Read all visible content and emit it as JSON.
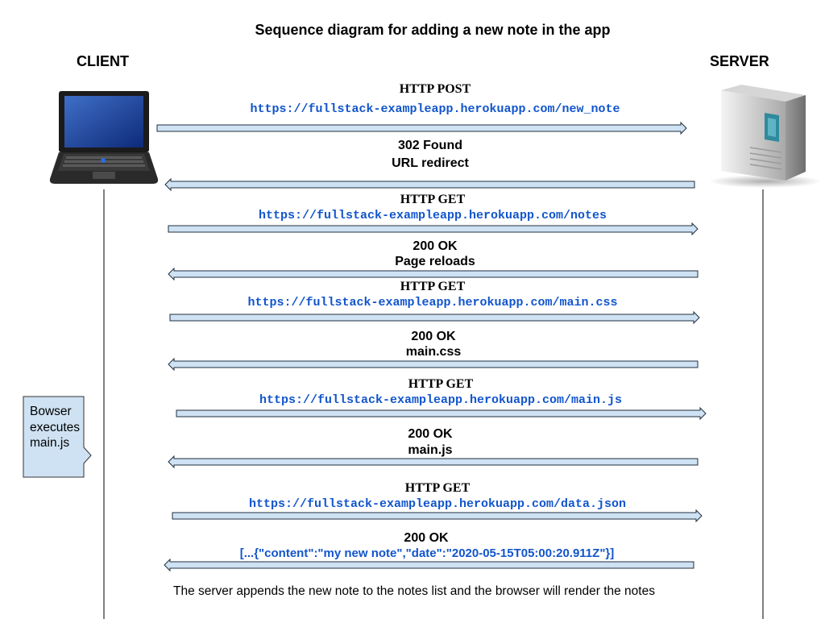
{
  "title": "Sequence diagram for adding a new note in the app",
  "actors": {
    "client": "CLIENT",
    "server": "SERVER"
  },
  "messages": [
    {
      "method": "HTTP POST",
      "url": "https://fullstack-exampleapp.herokuapp.com/new_note"
    },
    {
      "status": "302 Found",
      "detail": "URL redirect"
    },
    {
      "method": "HTTP GET",
      "url": "https://fullstack-exampleapp.herokuapp.com/notes"
    },
    {
      "status": "200 OK",
      "detail": "Page reloads"
    },
    {
      "method": "HTTP GET",
      "url": "https://fullstack-exampleapp.herokuapp.com/main.css"
    },
    {
      "status": "200 OK",
      "detail": "main.css"
    },
    {
      "method": "HTTP GET",
      "url": "https://fullstack-exampleapp.herokuapp.com/main.js"
    },
    {
      "status": "200 OK",
      "detail": "main.js"
    },
    {
      "method": "HTTP GET",
      "url": "https://fullstack-exampleapp.herokuapp.com/data.json"
    },
    {
      "status": "200 OK",
      "payload": "[...{\"content\":\"my new note\",\"date\":\"2020-05-15T05:00:20.911Z\"}]"
    }
  ],
  "note": {
    "line1": "Bowser",
    "line2": "executes",
    "line3": "main.js"
  },
  "footer": "The server appends the new note to the notes list and the browser will render the notes",
  "colors": {
    "arrow_fill": "#cfe2f3",
    "arrow_stroke": "#1f2f3f",
    "url": "#1155cc",
    "note_fill": "#cfe2f3"
  },
  "icons": {
    "client": "laptop-icon",
    "server": "server-tower-icon"
  }
}
